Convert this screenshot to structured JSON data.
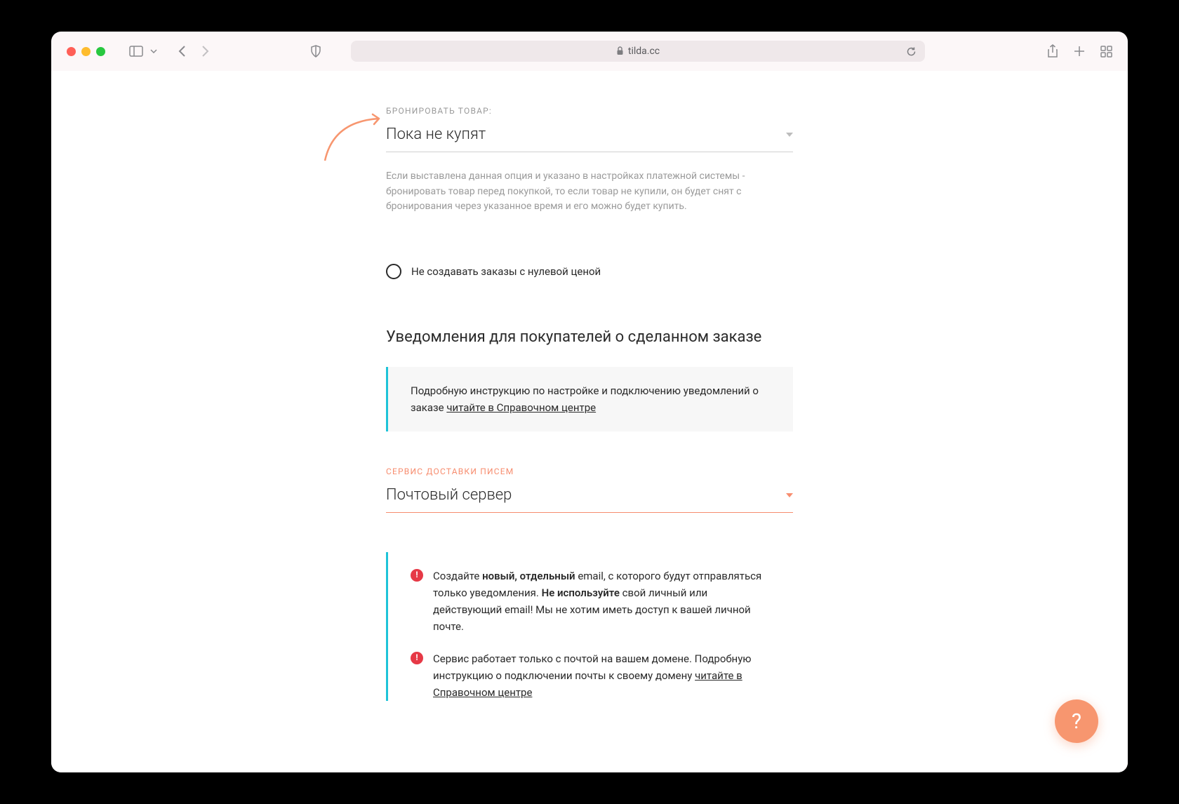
{
  "browser": {
    "url": "tilda.cc"
  },
  "reserve": {
    "label": "БРОНИРОВАТЬ ТОВАР:",
    "value": "Пока не купят",
    "help": "Если выставлена данная опция и указано в настройках платежной системы - бронировать товар перед покупкой, то если товар не купили, он будет снят с бронирования через указанное время и его можно будет купить."
  },
  "checkbox_zero": {
    "label": "Не создавать заказы с нулевой ценой"
  },
  "notifications": {
    "heading": "Уведомления для покупателей о сделанном заказе",
    "info_text": "Подробную инструкцию по настройке и подключению уведомлений о заказе ",
    "info_link": "читайте в Справочном центре"
  },
  "delivery": {
    "label": "СЕРВИС ДОСТАВКИ ПИСЕМ",
    "value": "Почтовый сервер"
  },
  "warnings": {
    "w1_p1": "Создайте ",
    "w1_b1": "новый, отдельный",
    "w1_p2": " email, с которого будут отправляться только уведомления. ",
    "w1_b2": "Не используйте",
    "w1_p3": " свой личный или действующий email! Мы не хотим иметь доступ к вашей личной почте.",
    "w2_p1": "Сервис работает только с почтой на вашем домене. Подробную инструкцию о подключении почты к своему домену ",
    "w2_link": "читайте в Справочном центре"
  },
  "fab": {
    "label": "?"
  }
}
